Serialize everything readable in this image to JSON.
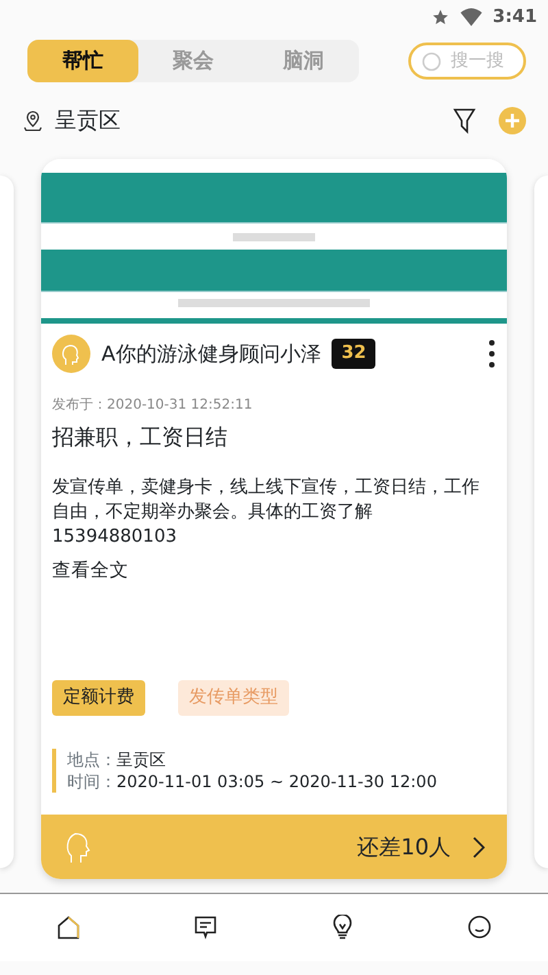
{
  "status_bar": {
    "time": "3:41"
  },
  "tabs": [
    {
      "label": "帮忙",
      "selected": true
    },
    {
      "label": "聚会",
      "selected": false
    },
    {
      "label": "脑洞",
      "selected": false
    }
  ],
  "search": {
    "placeholder": "搜一搜"
  },
  "location": "呈贡区",
  "post": {
    "author": "A你的游泳健身顾问小泽",
    "level_badge": "32",
    "published": "发布于：2020-10-31 12:52:11",
    "title": "招兼职，工资日结",
    "body": "发宣传单，卖健身卡，线上线下宣传，工资日结，工作自由，不定期举办聚会。具体的工资了解15394880103",
    "read_more": "查看全文",
    "tags": [
      {
        "label": "定额计费",
        "kind": "fee"
      },
      {
        "label": "发传单类型",
        "kind": "type"
      }
    ],
    "place_label": "地点：",
    "place": "呈贡区",
    "time_label": "时间：",
    "time": "2020-11-01 03:05 ~ 2020-11-30 12:00",
    "remaining": "还差10人"
  },
  "bottom_nav": [
    {
      "kind": "home",
      "selected": true
    },
    {
      "kind": "message",
      "selected": false
    },
    {
      "kind": "bulb",
      "selected": false
    },
    {
      "kind": "smile",
      "selected": false
    }
  ]
}
